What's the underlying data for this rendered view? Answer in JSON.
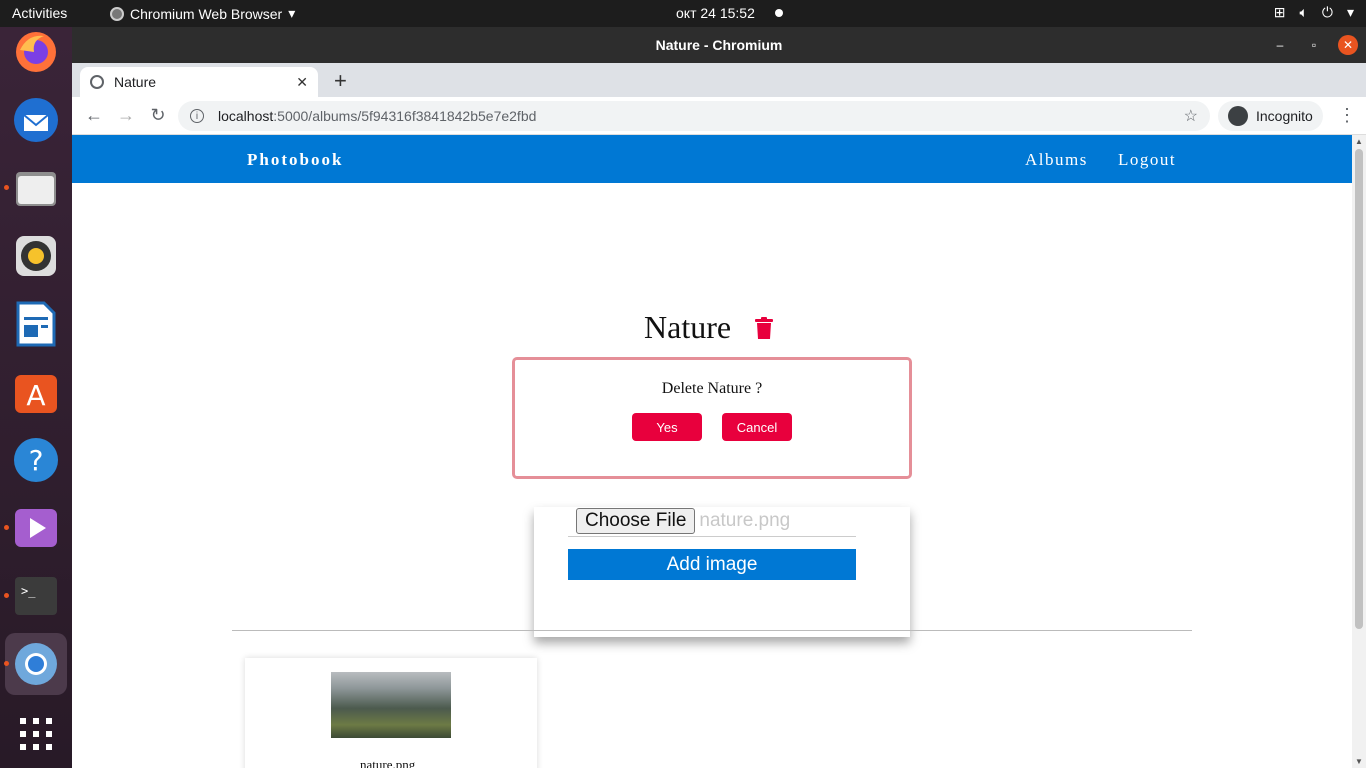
{
  "topbar": {
    "activities": "Activities",
    "app_name": "Chromium Web Browser",
    "clock": "окт 24  15:52"
  },
  "dock": {
    "items": [
      "firefox-icon",
      "thunderbird-icon",
      "files-icon",
      "rhythmbox-icon",
      "writer-icon",
      "app-center-icon",
      "help-icon",
      "video-icon",
      "terminal-icon",
      "chromium-icon",
      "show-apps-icon"
    ]
  },
  "window": {
    "title": "Nature - Chromium"
  },
  "browser": {
    "tab_title": "Nature",
    "url_host": "localhost",
    "url_path": ":5000/albums/5f94316f3841842b5e7e2fbd",
    "incognito_label": "Incognito"
  },
  "site": {
    "brand": "Photobook",
    "nav_albums": "Albums",
    "nav_logout": "Logout",
    "accent_color": "#0078d4",
    "danger_color": "#e8003d"
  },
  "album": {
    "title": "Nature",
    "confirm_question": "Delete Nature ?",
    "yes_label": "Yes",
    "cancel_label": "Cancel"
  },
  "upload": {
    "choose_label": "Choose File",
    "file_name": "nature.png",
    "add_label": "Add image"
  },
  "images": [
    {
      "name": "nature.png"
    }
  ]
}
